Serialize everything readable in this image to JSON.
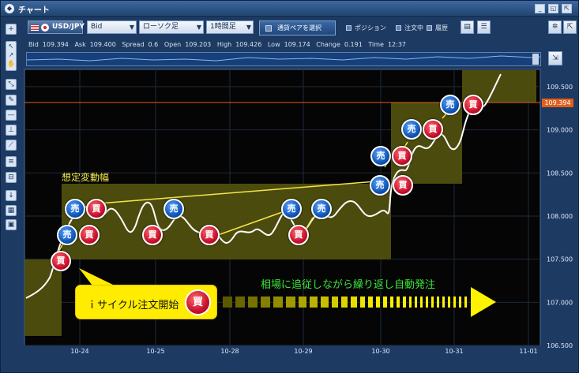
{
  "window": {
    "title": "チャート",
    "btn_min": "_",
    "btn_restore": "◱",
    "btn_float": "⇱",
    "btn_close": "×"
  },
  "toolbar": {
    "pair": "USD/JPY",
    "price_type": "Bid",
    "chart_type": "ローソク足",
    "interval": "1時間足",
    "select_pair": "通貨ペアを選択",
    "legend_position": "ポジション",
    "legend_order": "注文中",
    "legend_history": "履歴"
  },
  "quotes": {
    "bid_label": "Bid",
    "bid": "109.394",
    "ask_label": "Ask",
    "ask": "109.400",
    "spread_label": "Spread",
    "spread": "0.6",
    "open_label": "Open",
    "open": "109.203",
    "high_label": "High",
    "high": "109.426",
    "low_label": "Low",
    "low": "109.174",
    "change_label": "Change",
    "change": "0.191",
    "time_label": "Time",
    "time": "12:37"
  },
  "left_tools": [
    "+",
    "⤡",
    "✎",
    "—",
    "⊥",
    "⟋",
    "≡",
    "⊟",
    "↓",
    "▦",
    "▣"
  ],
  "annotation": {
    "width_label": "想定変動幅",
    "callout": "ｉサイクル注文開始",
    "callout_badge": "買",
    "auto_text": "相場に追従しながら繰り返し自動発注"
  },
  "markers": {
    "sell": "売",
    "buy": "買"
  },
  "current_price": "109.394",
  "colors": {
    "grid_band": "#5a5a10",
    "price_line": "#e0601a",
    "sell": "#1156b8",
    "buy": "#c8102e",
    "curve": "#ffffff"
  },
  "chart_data": {
    "type": "line",
    "x_ticks": [
      "10-24",
      "10-25",
      "10-28",
      "10-29",
      "10-30",
      "10-31",
      "11-01"
    ],
    "y_ticks": [
      "109.500",
      "109.000",
      "108.500",
      "108.000",
      "107.500",
      "107.000",
      "106.500"
    ],
    "ylim": [
      106.5,
      109.7
    ],
    "current_price": 109.394
  }
}
